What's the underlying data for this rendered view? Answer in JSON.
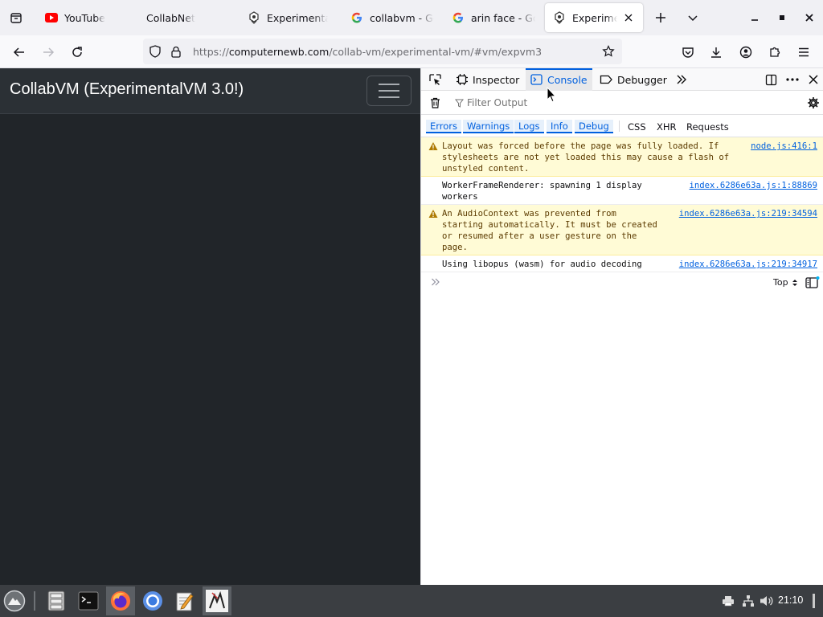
{
  "browser": {
    "tabs": [
      {
        "title": "YouTube",
        "icon": "youtube-icon",
        "active": false
      },
      {
        "title": "CollabNet",
        "icon": "",
        "active": false
      },
      {
        "title": "Experimental",
        "icon": "collabvm-icon",
        "active": false
      },
      {
        "title": "collabvm - Go",
        "icon": "google-icon",
        "active": false
      },
      {
        "title": "arin face - Go",
        "icon": "google-icon",
        "active": false
      },
      {
        "title": "Experiment",
        "icon": "collabvm-icon",
        "active": true
      }
    ],
    "url": {
      "prefix": "https://",
      "host": "computernewb.com",
      "path": "/collab-vm/experimental-vm/#vm/expvm3"
    }
  },
  "page": {
    "brand": "CollabVM (ExperimentalVM 3.0!)",
    "bg_color": "#212529"
  },
  "devtools": {
    "tabs": {
      "inspector": "Inspector",
      "console": "Console",
      "debugger": "Debugger"
    },
    "filter_placeholder": "Filter Output",
    "levels": [
      "Errors",
      "Warnings",
      "Logs",
      "Info",
      "Debug"
    ],
    "extra_filters": [
      "CSS",
      "XHR",
      "Requests"
    ],
    "messages": [
      {
        "type": "warning",
        "text": "Layout was forced before the page was fully loaded. If\nstylesheets are not yet loaded this may cause a flash of\nunstyled content.",
        "source": "node.js:416:1"
      },
      {
        "type": "log",
        "text": "WorkerFrameRenderer: spawning 1 display\nworkers",
        "source": "index.6286e63a.js:1:88869"
      },
      {
        "type": "warning",
        "text": "An AudioContext was prevented from\nstarting automatically. It must be created\nor resumed after a user gesture on the\npage.",
        "source": "index.6286e63a.js:219:34594"
      },
      {
        "type": "log",
        "text": "Using libopus (wasm) for audio decoding",
        "source": "index.6286e63a.js:219:34917"
      }
    ],
    "context_selector": "Top",
    "accent": "#0060df"
  },
  "taskbar": {
    "clock": "21:10"
  }
}
